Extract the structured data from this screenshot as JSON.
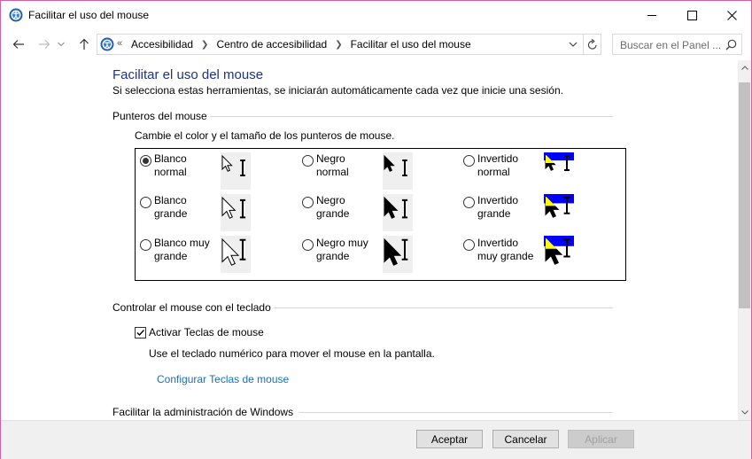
{
  "window": {
    "title": "Facilitar el uso del mouse",
    "accent_border": "#d35fa0"
  },
  "nav": {
    "back_icon": "arrow-left-icon",
    "forward_icon": "arrow-right-icon",
    "recent_icon": "chevron-down-icon",
    "up_icon": "arrow-up-icon",
    "breadcrumb_lead": "«",
    "breadcrumbs": [
      "Accesibilidad",
      "Centro de accesibilidad",
      "Facilitar el uso del mouse"
    ],
    "search_placeholder": "Buscar en el Panel ..."
  },
  "main": {
    "heading": "Facilitar el uso del mouse",
    "subtitle": "Si selecciona estas herramientas, se iniciarán automáticamente cada vez que inicie una sesión.",
    "pointers": {
      "section_title": "Punteros del mouse",
      "description": "Cambie el color y el tamaño de los punteros de mouse.",
      "options": [
        {
          "line1": "Blanco",
          "line2": "normal",
          "selected": true,
          "style": "white",
          "size": "normal"
        },
        {
          "line1": "Negro",
          "line2": "normal",
          "selected": false,
          "style": "black",
          "size": "normal"
        },
        {
          "line1": "Invertido",
          "line2": "normal",
          "selected": false,
          "style": "inverted",
          "size": "normal"
        },
        {
          "line1": "Blanco",
          "line2": "grande",
          "selected": false,
          "style": "white",
          "size": "large"
        },
        {
          "line1": "Negro",
          "line2": "grande",
          "selected": false,
          "style": "black",
          "size": "large"
        },
        {
          "line1": "Invertido",
          "line2": "grande",
          "selected": false,
          "style": "inverted",
          "size": "large"
        },
        {
          "line1": "Blanco muy",
          "line2": "grande",
          "selected": false,
          "style": "white",
          "size": "xlarge"
        },
        {
          "line1": "Negro muy",
          "line2": "grande",
          "selected": false,
          "style": "black",
          "size": "xlarge"
        },
        {
          "line1": "Invertido",
          "line2": "muy grande",
          "selected": false,
          "style": "inverted",
          "size": "xlarge"
        }
      ]
    },
    "keyboard": {
      "section_title": "Controlar el mouse con el teclado",
      "checkbox_label": "Activar Teclas de mouse",
      "checked": true,
      "description": "Use el teclado numérico para mover el mouse en la pantalla.",
      "link": "Configurar Teclas de mouse"
    },
    "windows_section_title": "Facilitar la administración de Windows"
  },
  "footer": {
    "accept": "Aceptar",
    "cancel": "Cancelar",
    "apply": "Aplicar",
    "apply_disabled": true
  },
  "colors": {
    "heading": "#1e3287",
    "link": "#1a6fb8",
    "inverted_blue": "#0000ff",
    "inverted_yellow": "#ffff00"
  }
}
